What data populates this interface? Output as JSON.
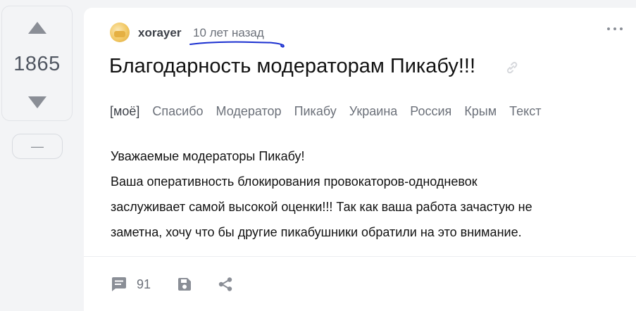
{
  "vote": {
    "score": "1865",
    "minus_label": "—"
  },
  "post": {
    "author": "xorayer",
    "time": "10 лет назад",
    "title": "Благодарность модераторам Пикабу!!!",
    "tags": [
      "[моё]",
      "Спасибо",
      "Модератор",
      "Пикабу",
      "Украина",
      "Россия",
      "Крым",
      "Текст"
    ],
    "body": [
      "Уважаемые модераторы Пикабу!",
      "Ваша оперативность блокирования провокаторов-однодневок",
      "заслуживает самой высокой оценки!!! Так как ваша работа зачастую не",
      "заметна, хочу что бы другие пикабушники обратили на это внимание."
    ]
  },
  "footer": {
    "comments_count": "91"
  },
  "colors": {
    "icon_gray": "#8a8e96",
    "annotation_blue": "#1a2fd0",
    "text_gray": "#6b7079"
  },
  "icons": [
    "arrow-up-icon",
    "arrow-down-icon",
    "link-icon",
    "more-dots-icon",
    "comment-icon",
    "save-icon",
    "share-icon"
  ]
}
